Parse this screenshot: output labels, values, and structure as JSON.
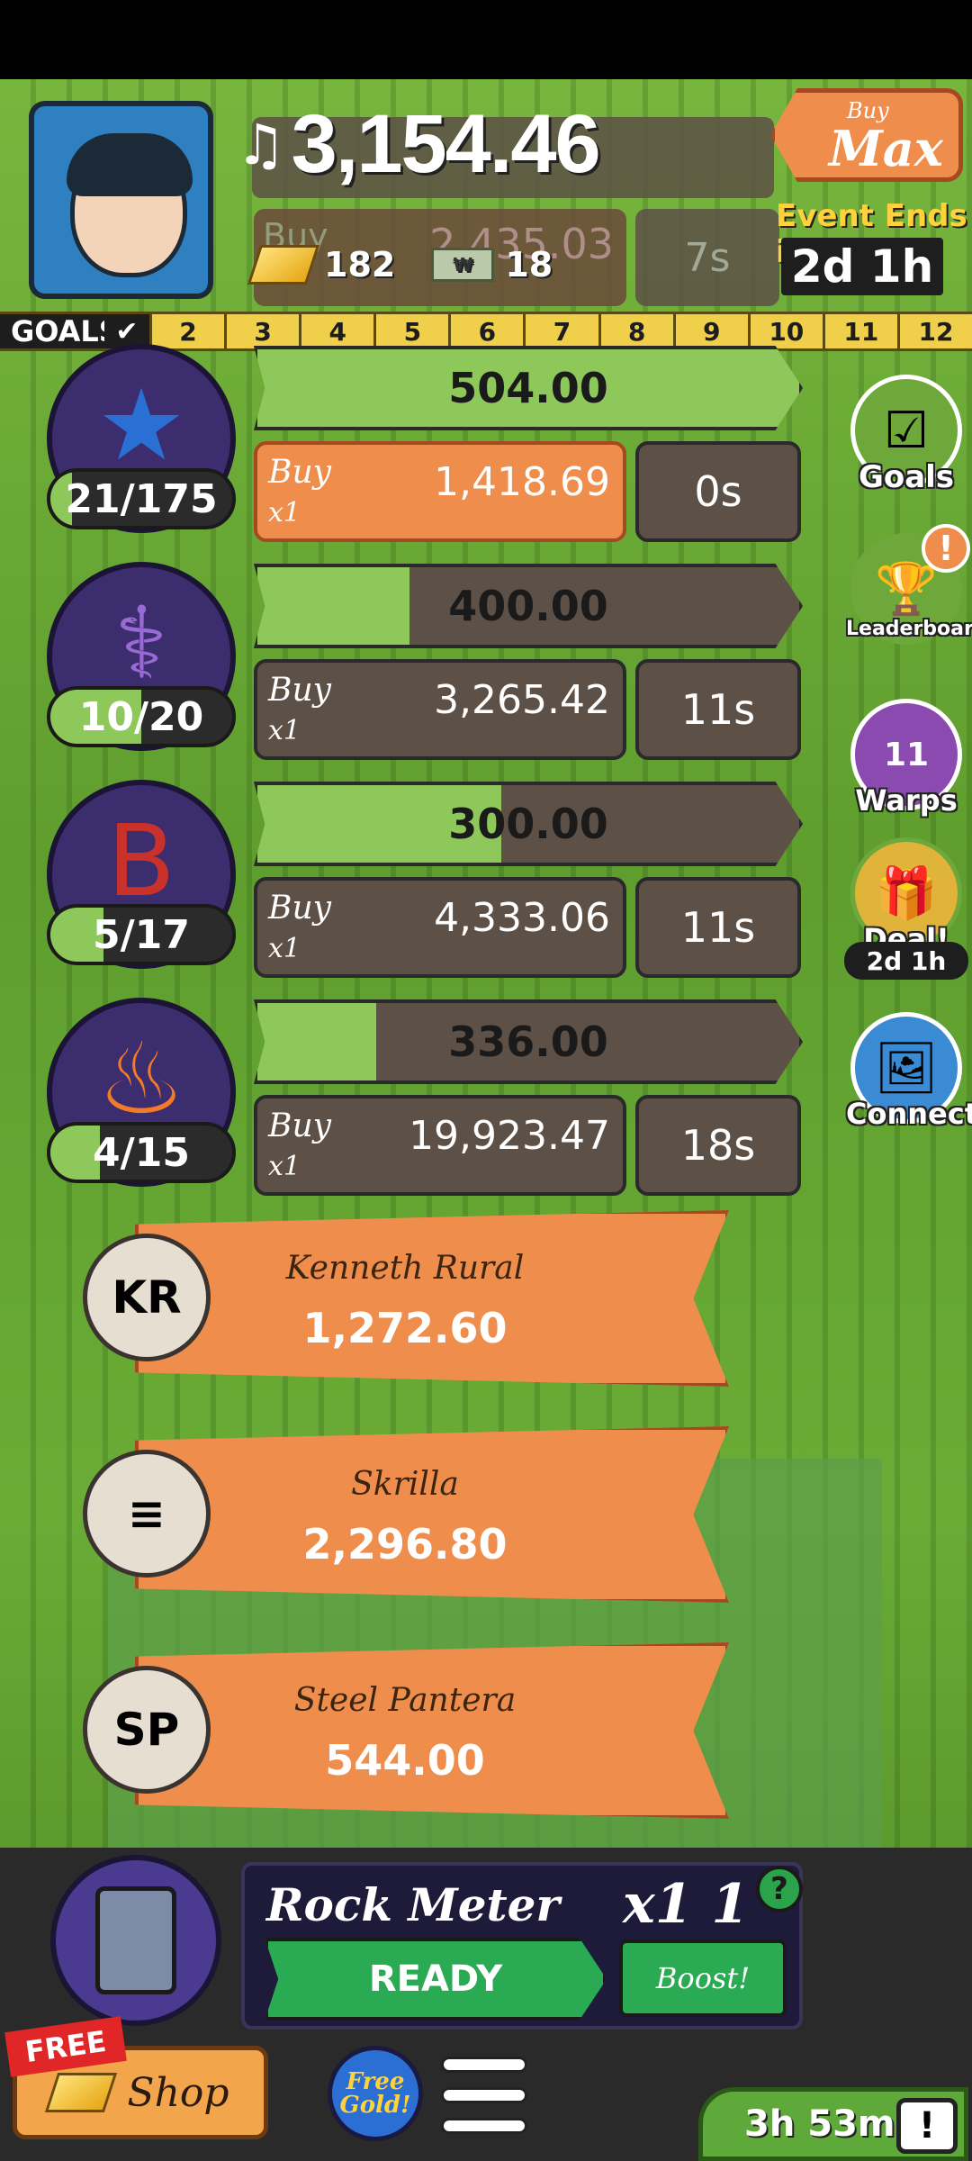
{
  "header": {
    "cash": "3,154.46",
    "gold": "182",
    "megabucks": "18",
    "buy_max": {
      "small": "Buy",
      "big": "Max"
    },
    "event_label": "Event Ends in:",
    "event_time": "2d 1h",
    "ghost_buy": {
      "label": "Buy",
      "value": "2,435.03",
      "time": "7s"
    }
  },
  "goals": {
    "label": "GOALS",
    "ticks": [
      "2",
      "3",
      "4",
      "5",
      "6",
      "7",
      "8",
      "9",
      "10",
      "11",
      "12"
    ]
  },
  "managers": [
    {
      "count": "21/175",
      "progress_value": "504.00",
      "progress_fraction": 1.0,
      "count_fraction": 0.12,
      "buy_label": "Buy",
      "buy_qty": "x1",
      "buy_cost": "1,418.69",
      "timer": "0s",
      "active": true,
      "icon": "star-icon",
      "color": "#2a6fd4"
    },
    {
      "count": "10/20",
      "progress_value": "400.00",
      "progress_fraction": 0.28,
      "count_fraction": 0.5,
      "buy_label": "Buy",
      "buy_qty": "x1",
      "buy_cost": "3,265.42",
      "timer": "11s",
      "active": false,
      "icon": "rune-icon",
      "color": "#9a6ad4"
    },
    {
      "count": "5/17",
      "progress_value": "300.00",
      "progress_fraction": 0.45,
      "count_fraction": 0.29,
      "buy_label": "Buy",
      "buy_qty": "x1",
      "buy_cost": "4,333.06",
      "timer": "11s",
      "active": false,
      "icon": "letter-b-icon",
      "color": "#c8322a"
    },
    {
      "count": "4/15",
      "progress_value": "336.00",
      "progress_fraction": 0.22,
      "count_fraction": 0.27,
      "buy_label": "Buy",
      "buy_qty": "x1",
      "buy_cost": "19,923.47",
      "timer": "18s",
      "active": false,
      "icon": "flame-icon",
      "color": "#f27a2a"
    }
  ],
  "unlocks": [
    {
      "name": "Kenneth Rural",
      "cost": "1,272.60",
      "badge": "KR"
    },
    {
      "name": "Skrilla",
      "cost": "2,296.80",
      "badge": "≡"
    },
    {
      "name": "Steel Pantera",
      "cost": "544.00",
      "badge": "SP"
    }
  ],
  "side": {
    "goals": "Goals",
    "leaderboard": "Leaderboard",
    "alert": "!",
    "warps_count": "11",
    "warps": "Warps",
    "deal": "Deal!",
    "deal_timer": "2d 1h",
    "connect": "Connect"
  },
  "rock": {
    "title": "Rock Meter",
    "multiplier": "x1 1",
    "help": "?",
    "ready": "READY",
    "boost": "Boost!"
  },
  "bottom": {
    "free_tag": "FREE",
    "shop": "Shop",
    "free_gold_1": "Free",
    "free_gold_2": "Gold!",
    "adv_timer": "3h 53m",
    "tv": "!"
  },
  "colors": {
    "accent_orange": "#ef8e4c",
    "progress_green": "#8ec85a",
    "panel_dark": "#5d5046",
    "gold": "#f0d04a"
  }
}
